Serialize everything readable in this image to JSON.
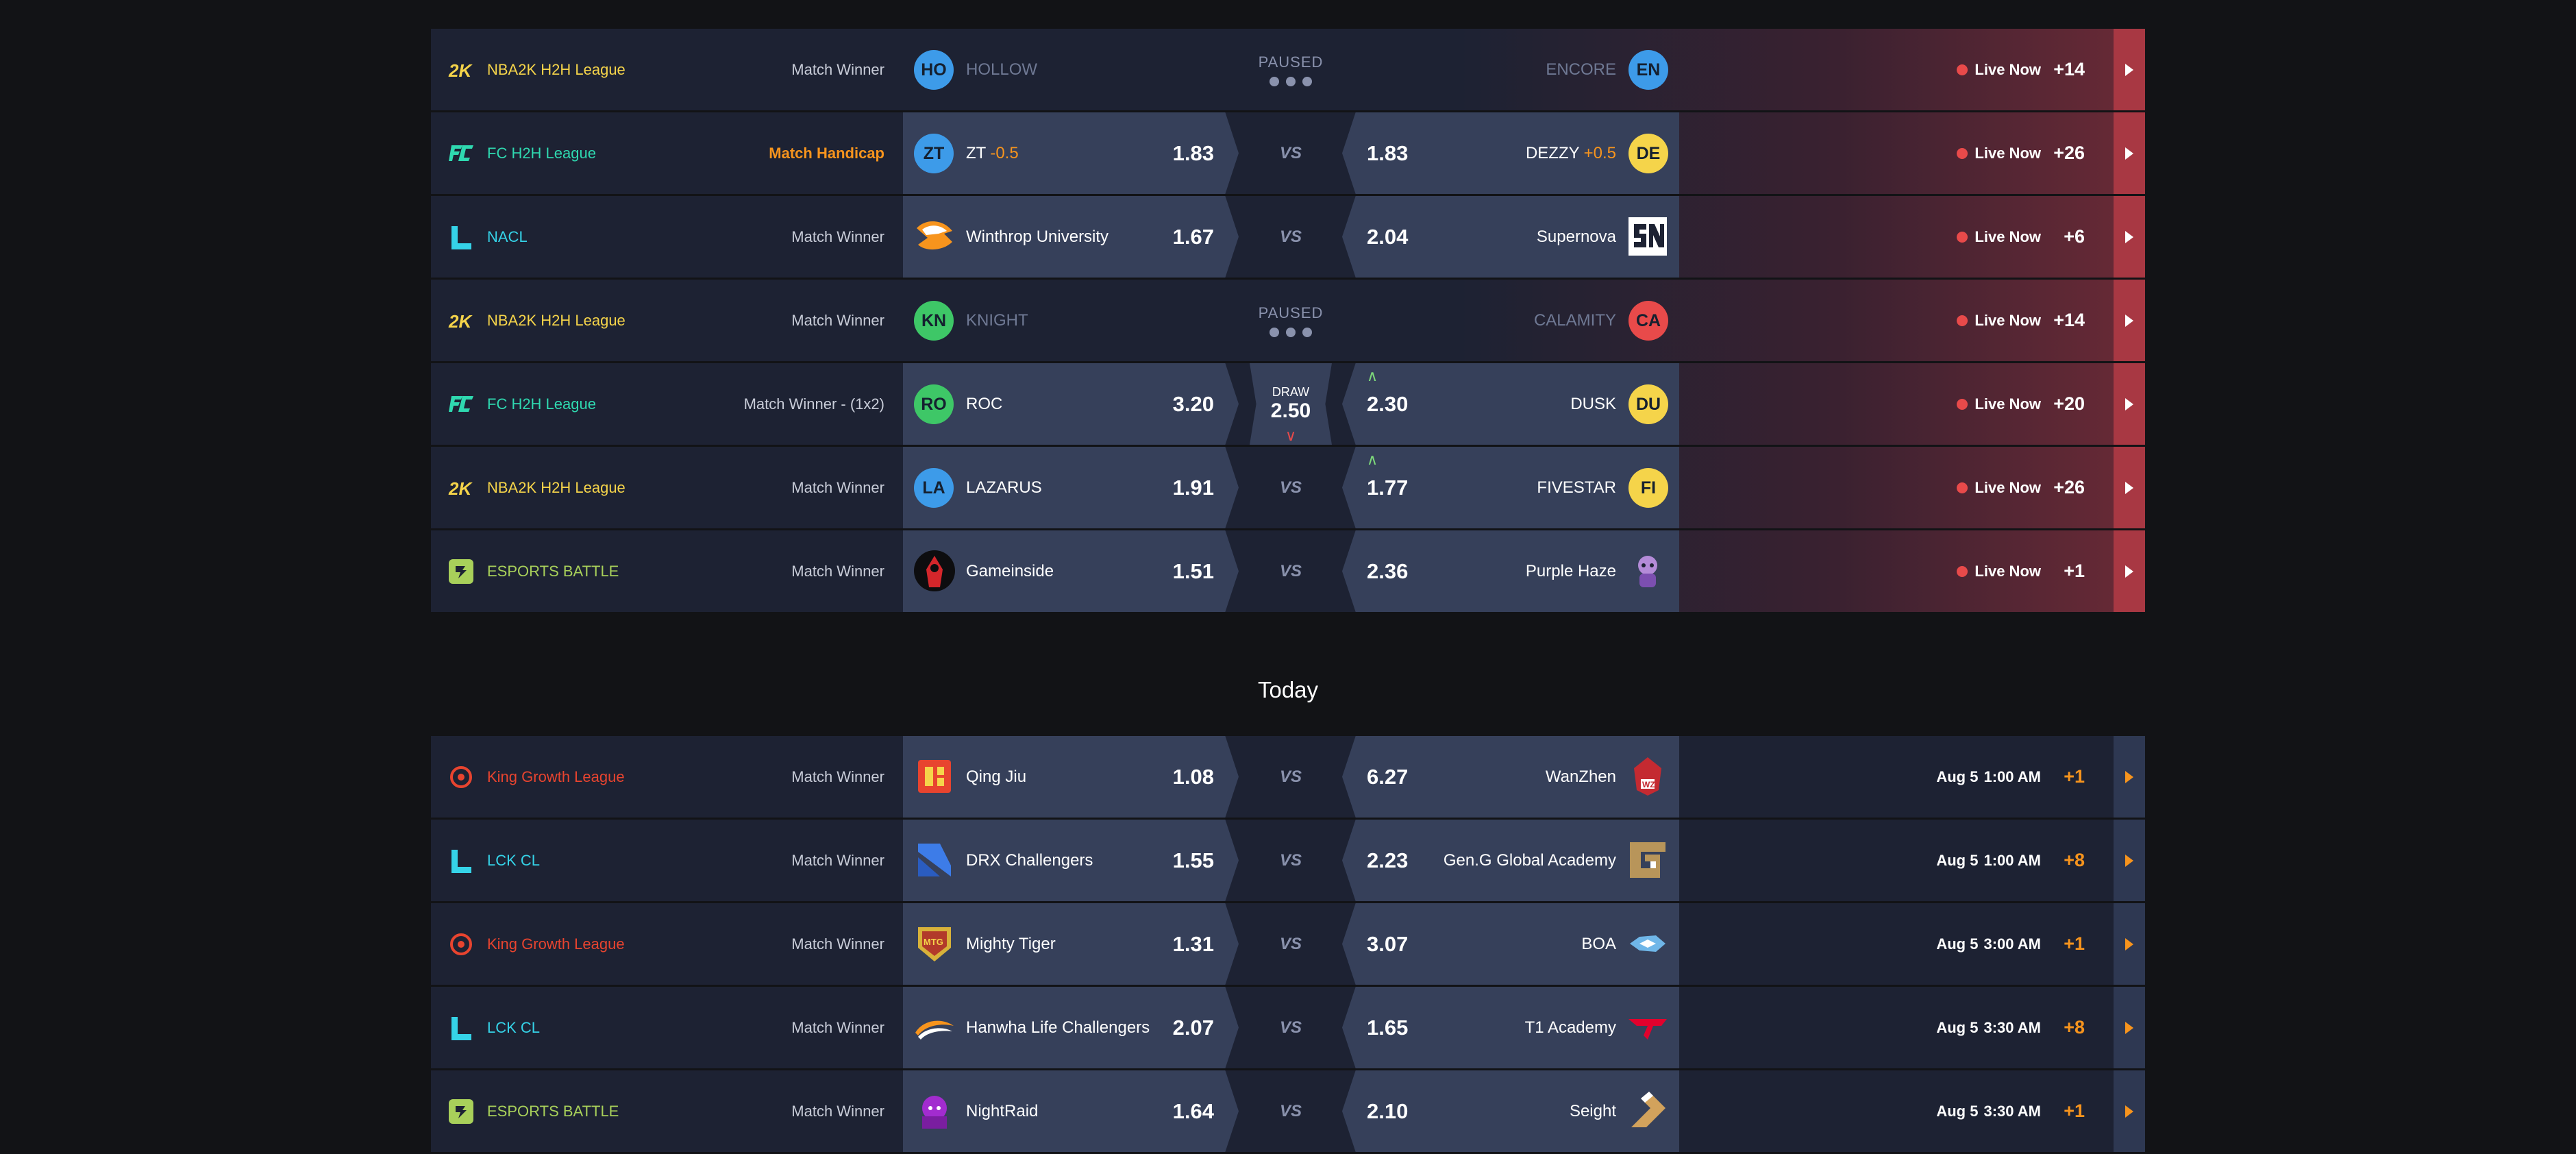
{
  "colors": {
    "accent": "#f7941d",
    "live": "#e84a4a",
    "row_bg": "#1d2233",
    "odds_bg": "#36405a",
    "page_bg": "#121316"
  },
  "live_rows": [
    {
      "league": "NBA2K H2H League",
      "league_color": "#f5d44a",
      "league_icon": "nba2k-icon",
      "market": "Match Winner",
      "home": {
        "abbr": "HO",
        "name": "HOLLOW",
        "avatar_color": "#3d9be9"
      },
      "away": {
        "abbr": "EN",
        "name": "ENCORE",
        "avatar_color": "#3d9be9"
      },
      "status": "PAUSED",
      "state": "Live Now",
      "more": "+14"
    },
    {
      "league": "FC H2H League",
      "league_color": "#2fd9b0",
      "league_icon": "fc-icon",
      "market": "Match Handicap",
      "home": {
        "abbr": "ZT",
        "name": "ZT",
        "handicap": "-0.5",
        "odds": "1.83",
        "avatar_color": "#3d9be9"
      },
      "away": {
        "abbr": "DE",
        "name": "DEZZY",
        "handicap": "+0.5",
        "odds": "1.83",
        "avatar_color": "#f5d44a"
      },
      "middle": "VS",
      "state": "Live Now",
      "more": "+26"
    },
    {
      "league": "NACL",
      "league_color": "#35d3e8",
      "league_icon": "nacl-icon",
      "market": "Match Winner",
      "home": {
        "name": "Winthrop University",
        "odds": "1.67",
        "logo": "eagle-logo"
      },
      "away": {
        "name": "Supernova",
        "odds": "2.04",
        "logo": "supernova-logo"
      },
      "middle": "VS",
      "state": "Live Now",
      "more": "+6"
    },
    {
      "league": "NBA2K H2H League",
      "league_color": "#f5d44a",
      "league_icon": "nba2k-icon",
      "market": "Match Winner",
      "home": {
        "abbr": "KN",
        "name": "KNIGHT",
        "avatar_color": "#3ec767"
      },
      "away": {
        "abbr": "CA",
        "name": "CALAMITY",
        "avatar_color": "#e84a4a"
      },
      "status": "PAUSED",
      "state": "Live Now",
      "more": "+14"
    },
    {
      "league": "FC H2H League",
      "league_color": "#2fd9b0",
      "league_icon": "fc-icon",
      "market": "Match Winner - (1x2)",
      "home": {
        "abbr": "RO",
        "name": "ROC",
        "odds": "3.20",
        "avatar_color": "#3ec767"
      },
      "away": {
        "abbr": "DU",
        "name": "DUSK",
        "odds": "2.30",
        "avatar_color": "#f5d44a"
      },
      "draw": {
        "label": "DRAW",
        "odds": "2.50"
      },
      "state": "Live Now",
      "more": "+20"
    },
    {
      "league": "NBA2K H2H League",
      "league_color": "#f5d44a",
      "league_icon": "nba2k-icon",
      "market": "Match Winner",
      "home": {
        "abbr": "LA",
        "name": "LAZARUS",
        "odds": "1.91",
        "avatar_color": "#3d9be9"
      },
      "away": {
        "abbr": "FI",
        "name": "FIVESTAR",
        "odds": "1.77",
        "avatar_color": "#f5d44a"
      },
      "middle": "VS",
      "state": "Live Now",
      "more": "+26"
    },
    {
      "league": "ESPORTS BATTLE",
      "league_color": "#a8d05a",
      "league_icon": "esports-battle-icon",
      "market": "Match Winner",
      "home": {
        "name": "Gameinside",
        "odds": "1.51",
        "logo": "gameinside-logo"
      },
      "away": {
        "name": "Purple Haze",
        "odds": "2.36",
        "logo": "purple-haze-logo"
      },
      "middle": "VS",
      "state": "Live Now",
      "more": "+1"
    }
  ],
  "today_heading": "Today",
  "today_rows": [
    {
      "league": "King Growth League",
      "league_color": "#e8442f",
      "league_icon": "king-growth-icon",
      "market": "Match Winner",
      "home": {
        "name": "Qing Jiu",
        "odds": "1.08",
        "logo": "qing-jiu-logo"
      },
      "away": {
        "name": "WanZhen",
        "odds": "6.27",
        "logo": "wanzhen-logo"
      },
      "middle": "VS",
      "date": "Aug 5",
      "time": "1:00 AM",
      "more": "+1"
    },
    {
      "league": "LCK CL",
      "league_color": "#35d3e8",
      "league_icon": "lck-icon",
      "market": "Match Winner",
      "home": {
        "name": "DRX Challengers",
        "odds": "1.55",
        "logo": "drx-logo"
      },
      "away": {
        "name": "Gen.G Global Academy",
        "odds": "2.23",
        "logo": "geng-logo"
      },
      "middle": "VS",
      "date": "Aug 5",
      "time": "1:00 AM",
      "more": "+8"
    },
    {
      "league": "King Growth League",
      "league_color": "#e8442f",
      "league_icon": "king-growth-icon",
      "market": "Match Winner",
      "home": {
        "name": "Mighty Tiger",
        "odds": "1.31",
        "logo": "mighty-tiger-logo"
      },
      "away": {
        "name": "BOA",
        "odds": "3.07",
        "logo": "boa-logo"
      },
      "middle": "VS",
      "date": "Aug 5",
      "time": "3:00 AM",
      "more": "+1"
    },
    {
      "league": "LCK CL",
      "league_color": "#35d3e8",
      "league_icon": "lck-icon",
      "market": "Match Winner",
      "home": {
        "name": "Hanwha Life Challengers",
        "odds": "2.07",
        "logo": "hanwha-logo"
      },
      "away": {
        "name": "T1 Academy",
        "odds": "1.65",
        "logo": "t1-logo"
      },
      "middle": "VS",
      "date": "Aug 5",
      "time": "3:30 AM",
      "more": "+8"
    },
    {
      "league": "ESPORTS BATTLE",
      "league_color": "#a8d05a",
      "league_icon": "esports-battle-icon",
      "market": "Match Winner",
      "home": {
        "name": "NightRaid",
        "odds": "1.64",
        "logo": "nightraid-logo"
      },
      "away": {
        "name": "Seight",
        "odds": "2.10",
        "logo": "seight-logo"
      },
      "middle": "VS",
      "date": "Aug 5",
      "time": "3:30 AM",
      "more": "+1"
    }
  ]
}
